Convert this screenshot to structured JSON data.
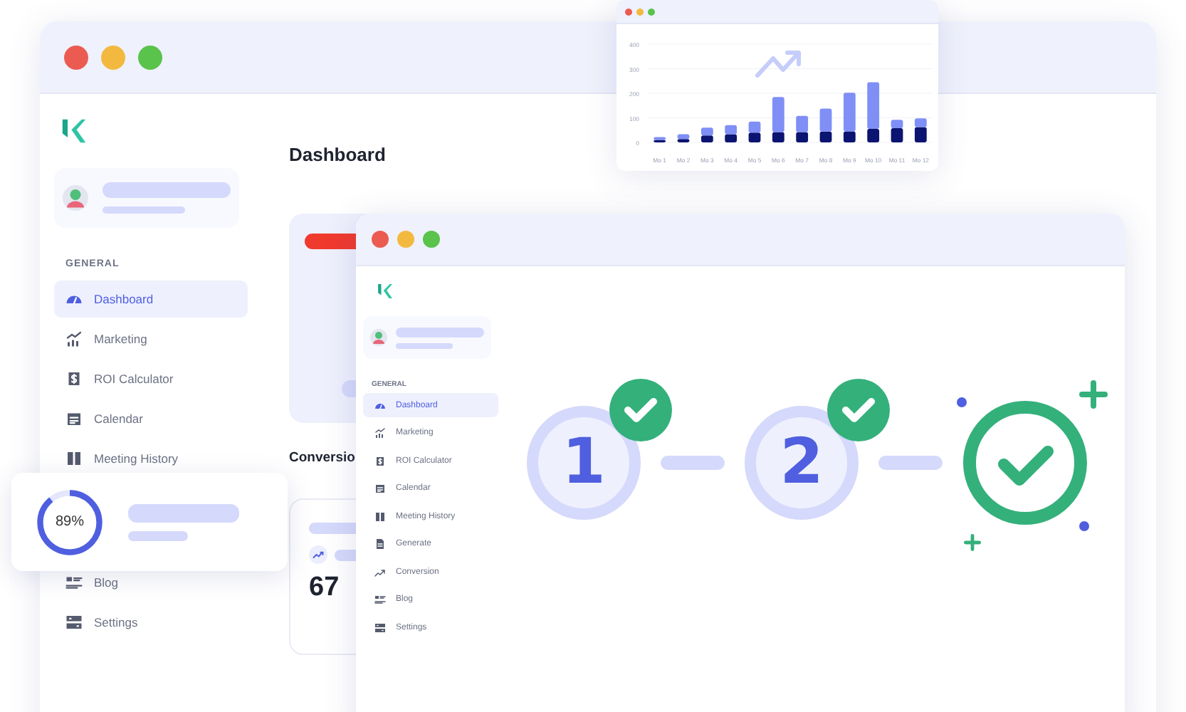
{
  "back_window": {
    "sidebar": {
      "section": "GENERAL",
      "items": [
        {
          "label": "Dashboard",
          "selected": true
        },
        {
          "label": "Marketing",
          "selected": false
        },
        {
          "label": "ROI Calculator",
          "selected": false
        },
        {
          "label": "Calendar",
          "selected": false
        },
        {
          "label": "Meeting History",
          "selected": false
        },
        {
          "label": "Blog",
          "selected": false
        },
        {
          "label": "Settings",
          "selected": false
        }
      ]
    },
    "heading": "Dashboard",
    "conversion_heading": "Conversio",
    "stat": "67"
  },
  "chart_window": {
    "chart_data": {
      "type": "bar",
      "stacked": true,
      "grid": true,
      "categories": [
        "Mo 1",
        "Mo 2",
        "Mo 3",
        "Mo 4",
        "Mo 5",
        "Mo 6",
        "Mo 7",
        "Mo 8",
        "Mo 9",
        "Mo 10",
        "Mo 11",
        "Mo 12"
      ],
      "ylim": [
        0,
        400
      ],
      "yticks": [
        0,
        100,
        200,
        300,
        400
      ],
      "series": [
        {
          "color": "#0b1470",
          "values": [
            10,
            14,
            28,
            33,
            40,
            42,
            42,
            44,
            45,
            55,
            58,
            62
          ]
        },
        {
          "color": "#7f8ff6",
          "values": [
            12,
            19,
            32,
            37,
            45,
            143,
            66,
            94,
            157,
            190,
            34,
            36
          ]
        }
      ]
    }
  },
  "progress_card": {
    "level": 0.89,
    "reading": "89%"
  },
  "front_window": {
    "sidebar": {
      "section": "GENERAL",
      "items": [
        {
          "label": "Dashboard",
          "selected": true
        },
        {
          "label": "Marketing",
          "selected": false
        },
        {
          "label": "ROI Calculator",
          "selected": false
        },
        {
          "label": "Calendar",
          "selected": false
        },
        {
          "label": "Meeting History",
          "selected": false
        },
        {
          "label": "Generate",
          "selected": false
        },
        {
          "label": "Conversion",
          "selected": false
        },
        {
          "label": "Blog",
          "selected": false
        },
        {
          "label": "Settings",
          "selected": false
        }
      ]
    },
    "steps": [
      {
        "label": "1",
        "done": true
      },
      {
        "label": "2",
        "done": true
      }
    ],
    "final_step": {
      "done": true
    }
  }
}
